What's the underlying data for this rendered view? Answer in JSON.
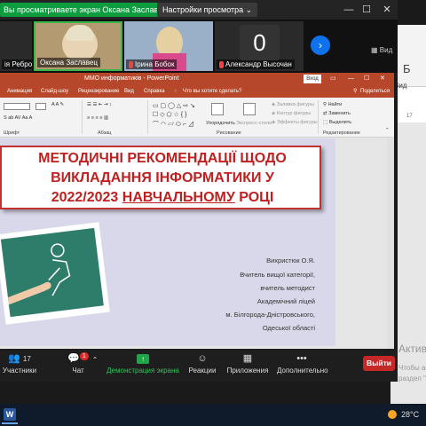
{
  "zoom": {
    "sharing_text": "Вы просматриваете экран Оксана Заславец",
    "view_options": "Настройки просмотра",
    "participants": [
      {
        "name": "ія Ребро..."
      },
      {
        "name": "Оксана Заславец"
      },
      {
        "name": "Ірина Бобок"
      },
      {
        "name": "Александр Высочан"
      }
    ],
    "avatar_letter": "0",
    "view_label": "Вид",
    "toolbar": {
      "participants_count": "17",
      "participants_label": "Участники",
      "chat_label": "Чат",
      "chat_badge": "1",
      "share_label": "Демонстрация экрана",
      "reactions_label": "Реакции",
      "apps_label": "Приложения",
      "more_label": "Дополнительно",
      "leave_label": "Выйти"
    }
  },
  "powerpoint": {
    "title": "ММО информатиків - PowerPoint",
    "signin": "Вход",
    "tabs": [
      "Анимация",
      "Слайд-шоу",
      "Рецензирование",
      "Вид",
      "Справка",
      "Что вы хотите сделать?",
      "Поделиться"
    ],
    "ribbon": {
      "group_font": "Шрифт",
      "group_paragraph": "Абзац",
      "group_drawing": "Рисование",
      "group_editing": "Редактирование",
      "arrange": "Упорядочить",
      "quick_styles": "Экспресс-стили",
      "fill": "Заливка фигуры",
      "outline": "Контур фигуры",
      "effects": "Эффекты фигуры",
      "find": "Найти",
      "replace": "Заменить",
      "select": "Выделить"
    },
    "slide": {
      "title_line1": "МЕТОДИЧНІ РЕКОМЕНДАЦІЇ ЩОДО",
      "title_line2": "ВИКЛАДАННЯ ІНФОРМАТИКИ У",
      "title_line3_pre": "2022/2023 ",
      "title_line3_u": "НАВЧАЛЬНОМУ",
      "title_line3_post": " РОЦІ",
      "author": [
        "Вихристюк О.Я.",
        "Вчитель вищої категорії,",
        "вчитель методист",
        "Академічний ліцей",
        "м. Білгорода-Дністровського,",
        "Одеської області"
      ]
    }
  },
  "background_window": {
    "letter": "Б",
    "view": "Вид",
    "ruler": "17"
  },
  "activation": {
    "line1": "Актива",
    "line2": "Чтобы ак",
    "line3": "раздел \"П"
  },
  "taskbar": {
    "word_icon": "W",
    "temperature": "28°C"
  }
}
